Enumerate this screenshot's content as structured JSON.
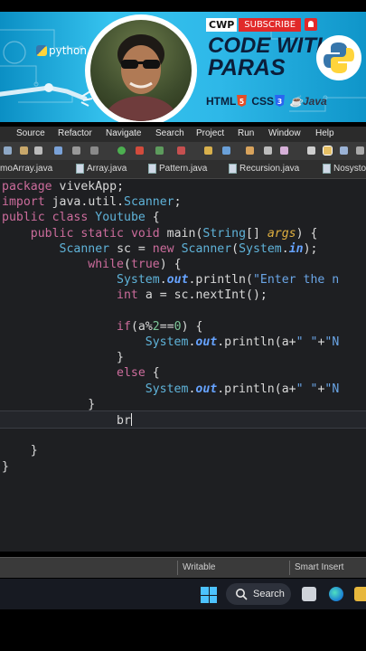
{
  "banner": {
    "python_label": "python",
    "badge_cwp": "CWP",
    "badge_subscribe": "SUBSCRIBE",
    "title_line1": "CODE WITH",
    "title_line2": "PARAS",
    "tags": [
      "HTML",
      "CSS",
      "Java"
    ],
    "colors": {
      "bg": "#2eb8e8",
      "title": "#0b1e3a",
      "subscribe": "#e12a2a"
    }
  },
  "menubar": {
    "items": [
      "Source",
      "Refactor",
      "Navigate",
      "Search",
      "Project",
      "Run",
      "Window",
      "Help"
    ]
  },
  "tabs": [
    "moArray.java",
    "Array.java",
    "Pattern.java",
    "Recursion.java",
    "Nosysto"
  ],
  "code": {
    "lines": [
      "package vivekApp;",
      "import java.util.Scanner;",
      "public class Youtube {",
      "    public static void main(String[] args) {",
      "        Scanner sc = new Scanner(System.in);",
      "            while(true) {",
      "                System.out.println(\"Enter the n",
      "                int a = sc.nextInt();",
      "",
      "                if(a%2==0) {",
      "                    System.out.println(a+\" \"+\"N",
      "                }",
      "                else {",
      "                    System.out.println(a+\" \"+\"N",
      "            }",
      "                br",
      "",
      "    }",
      "}"
    ]
  },
  "statusbar": {
    "mode": "Writable",
    "insert": "Smart Insert"
  },
  "taskbar": {
    "search_label": "Search"
  }
}
